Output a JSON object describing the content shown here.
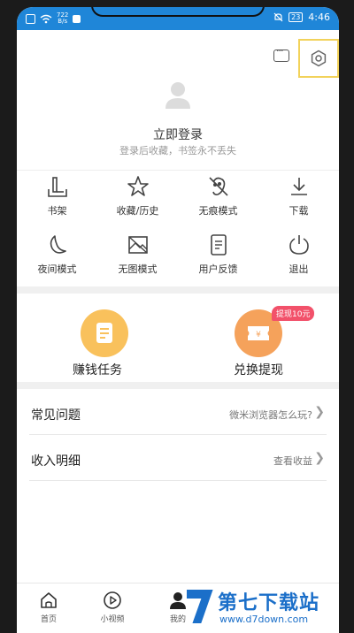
{
  "status_bar": {
    "net_speed_top": "722",
    "net_speed_bottom": "B/s",
    "battery": "23",
    "time": "4:46"
  },
  "profile": {
    "login_label": "立即登录",
    "login_sub": "登录后收藏，书签永不丢失"
  },
  "grid": [
    {
      "label": "书架",
      "icon": "bookshelf-icon"
    },
    {
      "label": "收藏/历史",
      "icon": "star-icon"
    },
    {
      "label": "无痕模式",
      "icon": "incognito-icon"
    },
    {
      "label": "下载",
      "icon": "download-icon"
    },
    {
      "label": "夜间模式",
      "icon": "moon-icon"
    },
    {
      "label": "无图模式",
      "icon": "no-image-icon"
    },
    {
      "label": "用户反馈",
      "icon": "feedback-icon"
    },
    {
      "label": "退出",
      "icon": "power-icon"
    }
  ],
  "tasks": {
    "earn_label": "赚钱任务",
    "redeem_label": "兑换提现",
    "redeem_badge": "提现10元",
    "earn_color": "#f9c15c",
    "redeem_color": "#f5a25b"
  },
  "rows": [
    {
      "title": "常见问题",
      "hint": "微米浏览器怎么玩?"
    },
    {
      "title": "收入明细",
      "hint": "查看收益"
    }
  ],
  "bottom_nav": [
    {
      "label": "首页",
      "icon": "home-icon"
    },
    {
      "label": "小视频",
      "icon": "video-icon"
    },
    {
      "label": "我的",
      "icon": "person-icon"
    }
  ],
  "watermark": {
    "text": "第七下载站",
    "url": "www.d7down.com"
  },
  "colors": {
    "status_bar": "#1f86d8",
    "highlight_border": "#f2d25a",
    "badge": "#f2516a"
  }
}
